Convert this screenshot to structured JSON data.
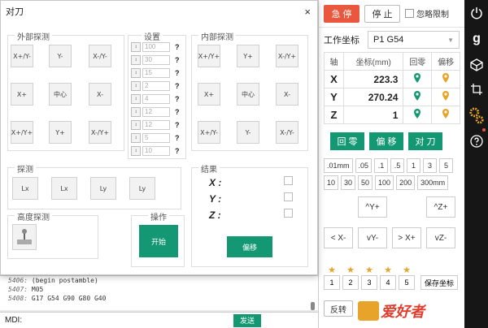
{
  "dialog": {
    "title": "对刀",
    "close": "×",
    "groups": {
      "outer": "外部探测",
      "settings": "设置",
      "inner": "内部探测",
      "probe": "探测",
      "height": "高度探测",
      "operate": "操作",
      "result": "结果"
    },
    "outer_tiles": [
      "X+/Y-",
      "Y-",
      "X-/Y-",
      "X+",
      "中心",
      "X-",
      "X+/Y+",
      "Y+",
      "X-/Y+"
    ],
    "inner_tiles": [
      "X+/Y+",
      "Y+",
      "X-/Y+",
      "X+",
      "中心",
      "X-",
      "X+/Y-",
      "Y-",
      "X-/Y-"
    ],
    "probe_tiles": [
      "Lx",
      "Lx",
      "Ly",
      "Ly"
    ],
    "settings": [
      {
        "value": "100"
      },
      {
        "value": "30"
      },
      {
        "value": "15"
      },
      {
        "value": "2"
      },
      {
        "value": "4"
      },
      {
        "value": "12"
      },
      {
        "value": "12"
      },
      {
        "value": "5"
      },
      {
        "value": "10"
      }
    ],
    "help": "?",
    "start_label": "开始",
    "offset_label": "偏移",
    "results": [
      "X :",
      "Y :",
      "Z :"
    ]
  },
  "console": {
    "lines": [
      {
        "num": "5406:",
        "text": "(begin postamble)"
      },
      {
        "num": "5407:",
        "text": "M05"
      },
      {
        "num": "5408:",
        "text": "G17 G54 G90 G80 G40"
      }
    ],
    "mdi_label": "MDI:",
    "send_label": "发送"
  },
  "right": {
    "estop": "急 停",
    "stop": "停 止",
    "ignore_limit": "忽略限制",
    "wcs_label": "工作坐标",
    "wcs_value": "P1 G54",
    "table_headers": [
      "轴",
      "坐标(mm)",
      "回零",
      "偏移"
    ],
    "axes": [
      {
        "name": "X",
        "value": "223.3"
      },
      {
        "name": "Y",
        "value": "270.24"
      },
      {
        "name": "Z",
        "value": "1"
      }
    ],
    "buttons": {
      "home": "回 零",
      "offset": "偏 移",
      "probe": "对 刀"
    },
    "steps": [
      ".01mm",
      ".05",
      ".1",
      ".5",
      "1",
      "3",
      "5",
      "10",
      "30",
      "50",
      "100",
      "200",
      "300mm"
    ],
    "jog": {
      "yp": "Y+",
      "zp": "Z+",
      "xm": "X-",
      "ym": "Y-",
      "xp": "X+",
      "zm": "Z-"
    },
    "slots": [
      "1",
      "2",
      "3",
      "4",
      "5"
    ],
    "save_coords": "保存坐标",
    "reverse": "反转",
    "watermark": "爱好者"
  },
  "colors": {
    "accent": "#139873",
    "danger": "#e9573e",
    "star": "#e8a42a",
    "strip": "#161616"
  }
}
